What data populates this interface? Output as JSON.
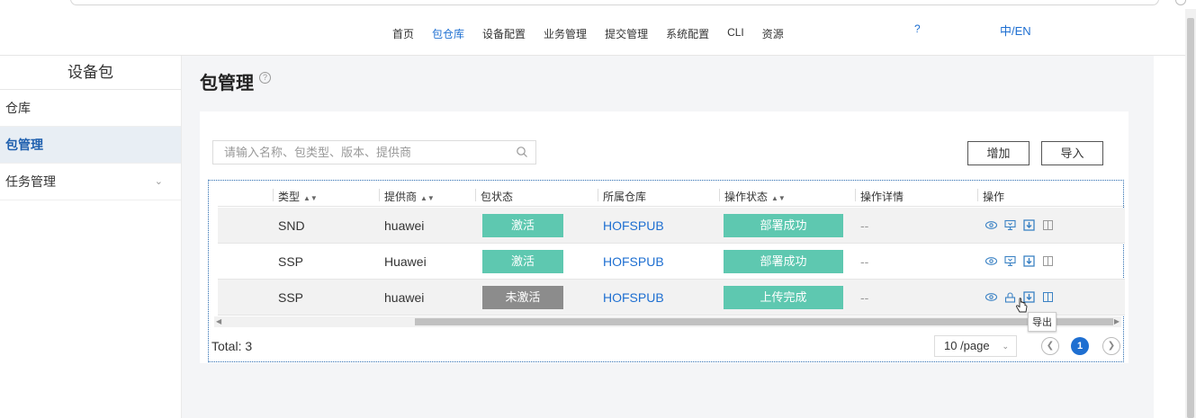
{
  "header": {
    "nav": [
      "首页",
      "包仓库",
      "设备配置",
      "业务管理",
      "提交管理",
      "系统配置",
      "CLI",
      "资源"
    ],
    "active_index": 1,
    "help": "?",
    "lang": "中/EN"
  },
  "sidebar": {
    "title": "设备包",
    "items": [
      {
        "label": "仓库"
      },
      {
        "label": "包管理",
        "active": true
      },
      {
        "label": "任务管理",
        "expandable": true
      }
    ]
  },
  "main": {
    "title": "包管理",
    "search_placeholder": "请输入名称、包类型、版本、提供商",
    "add_label": "增加",
    "import_label": "导入",
    "columns": [
      "类型",
      "提供商",
      "包状态",
      "所属仓库",
      "操作状态",
      "操作详情",
      "操作"
    ],
    "rows": [
      {
        "type": "SND",
        "provider": "huawei",
        "pkg_status": "激活",
        "pkg_status_color": "#5ec8b0",
        "repo": "HOFSPUB",
        "op_status": "部署成功",
        "detail": "--"
      },
      {
        "type": "SSP",
        "provider": "Huawei",
        "pkg_status": "激活",
        "pkg_status_color": "#5ec8b0",
        "repo": "HOFSPUB",
        "op_status": "部署成功",
        "detail": "--"
      },
      {
        "type": "SSP",
        "provider": "huawei",
        "pkg_status": "未激活",
        "pkg_status_color": "#8c8c8c",
        "repo": "HOFSPUB",
        "op_status": "上传完成",
        "detail": "--"
      }
    ],
    "tooltip": "导出",
    "total": "Total: 3",
    "page_size": "10 /page",
    "current_page": "1"
  },
  "colors": {
    "accent": "#1e6fd1",
    "status_green": "#5ec8b0",
    "status_gray": "#8c8c8c"
  }
}
